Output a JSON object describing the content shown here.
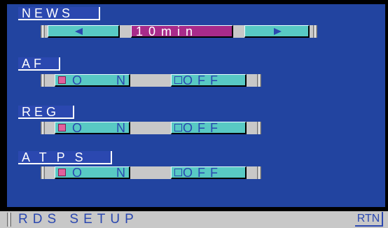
{
  "settings": {
    "news": {
      "label": "NEWS",
      "value": "10min"
    },
    "af": {
      "label": "AF",
      "on_label": "O N",
      "off_label": "OFF",
      "selected": "ON"
    },
    "reg": {
      "label": "REG",
      "on_label": "O N",
      "off_label": "OFF",
      "selected": "ON"
    },
    "atps": {
      "label": "ATPS",
      "on_label": "O N",
      "off_label": "OFF",
      "selected": "ON"
    }
  },
  "footer": {
    "title": "RDS SETUP",
    "return_label": "RTN"
  },
  "colors": {
    "background": "#2244a0",
    "button": "#58c9c4",
    "value_highlight": "#a82b8a",
    "selected_indicator": "#e0609c",
    "track": "#c8c8c8",
    "text": "#2b48b0"
  }
}
